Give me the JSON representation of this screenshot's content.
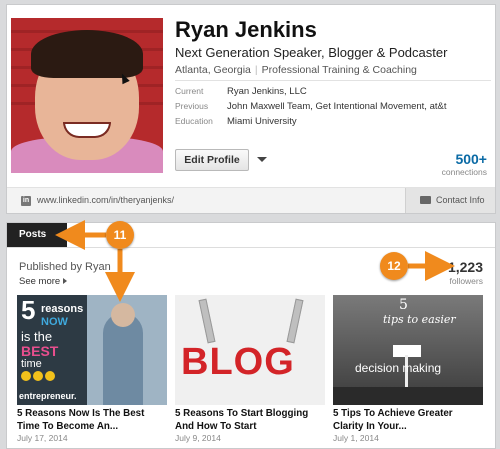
{
  "profile": {
    "name": "Ryan Jenkins",
    "headline": "Next Generation Speaker, Blogger & Podcaster",
    "location": "Atlanta, Georgia",
    "industry": "Professional Training & Coaching",
    "current_label": "Current",
    "current_value": "Ryan Jenkins, LLC",
    "previous_label": "Previous",
    "previous_value": "John Maxwell Team, Get Intentional Movement, at&t",
    "education_label": "Education",
    "education_value": "Miami University",
    "edit_button": "Edit Profile",
    "connections_count": "500+",
    "connections_label": "connections",
    "url": "www.linkedin.com/in/theryanjenks/",
    "contact_info": "Contact Info"
  },
  "posts": {
    "tab_label": "Posts",
    "published_by": "Published by Ryan",
    "see_more": "See more",
    "followers_count": "1,223",
    "followers_label": "followers",
    "items": [
      {
        "title": "5 Reasons Now Is The Best Time To Become An...",
        "date": "July 17, 2014",
        "thumb": {
          "big_number": "5",
          "word1": "reasons",
          "word2": "NOW",
          "word3": "is the",
          "word4": "BEST",
          "word5": "time",
          "word6": "entrepreneur."
        }
      },
      {
        "title": "5 Reasons To Start Blogging And How To Start",
        "date": "July 9, 2014",
        "thumb": {
          "word": "BLOG"
        }
      },
      {
        "title": "5 Tips To Achieve Greater Clarity In Your...",
        "date": "July 1, 2014",
        "thumb": {
          "number": "5",
          "tips": "tips to easier",
          "caption": "decision making"
        }
      }
    ]
  },
  "annotations": {
    "callout_11": "11",
    "callout_12": "12",
    "accent_color": "#f08a1d"
  },
  "icons": [
    "linkedin-icon",
    "contact-card-icon",
    "dropdown-caret-icon",
    "chevron-right-icon",
    "mouse-cursor-icon"
  ]
}
